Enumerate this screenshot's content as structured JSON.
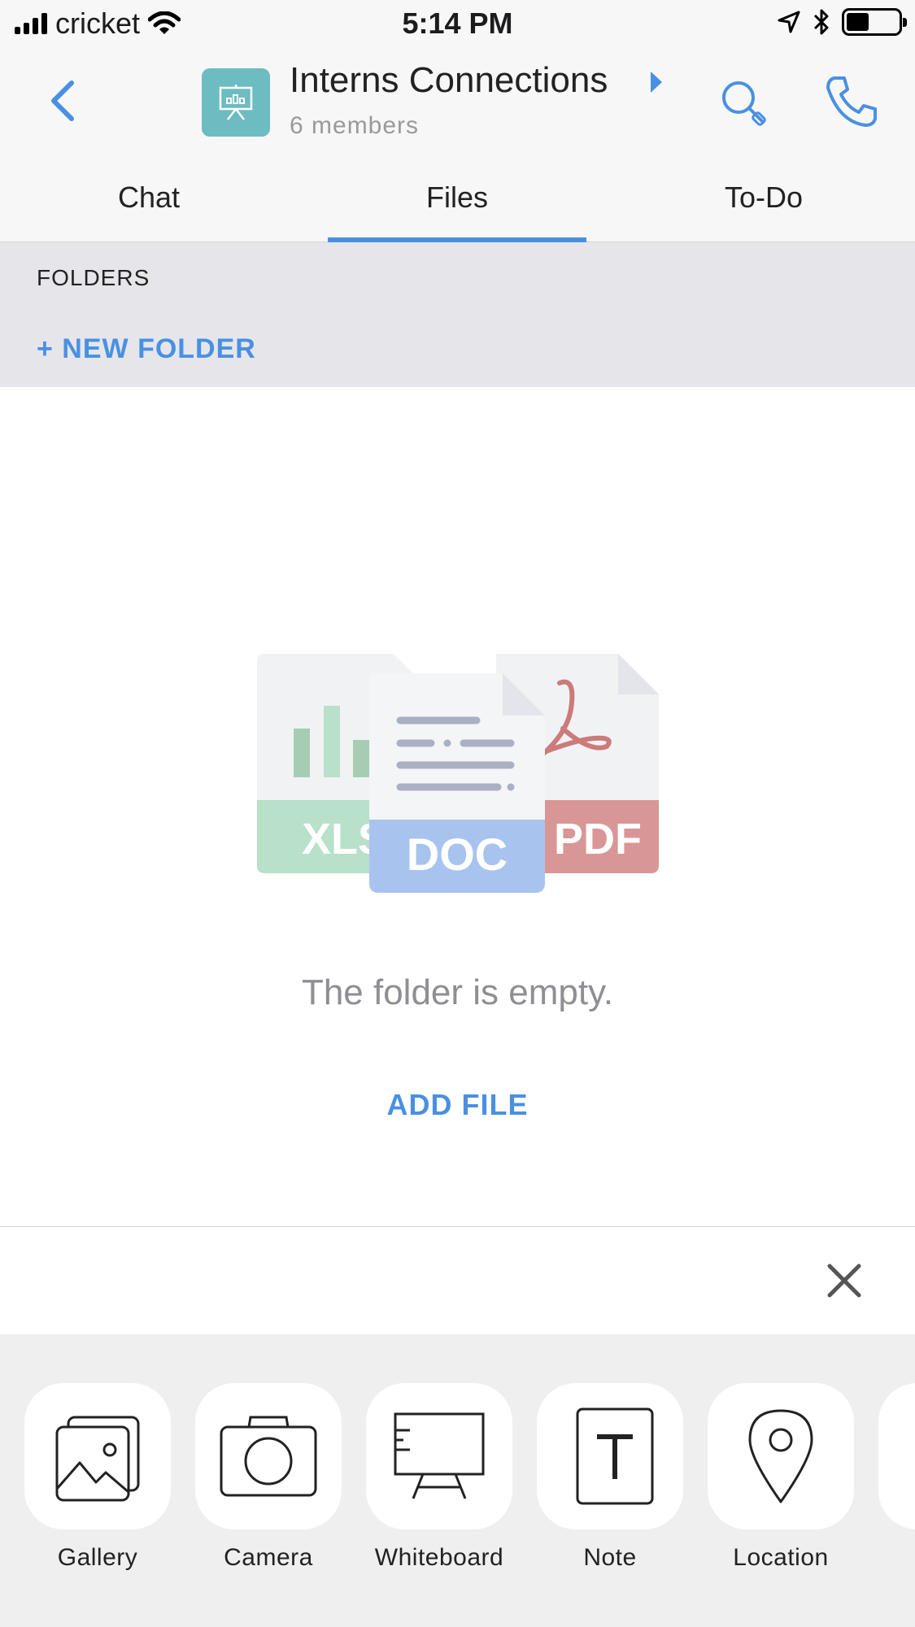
{
  "status_bar": {
    "carrier": "cricket",
    "time": "5:14 PM"
  },
  "header": {
    "title": "Interns Connections",
    "subtitle": "6 members"
  },
  "tabs": [
    {
      "label": "Chat",
      "active": false
    },
    {
      "label": "Files",
      "active": true
    },
    {
      "label": "To-Do",
      "active": false
    }
  ],
  "folders": {
    "section_label": "FOLDERS",
    "new_folder": "+ NEW FOLDER"
  },
  "empty_state": {
    "illustration_labels": {
      "xls": "XLS",
      "doc": "DOC",
      "pdf": "PDF"
    },
    "message": "The folder is empty.",
    "action": "ADD FILE"
  },
  "tray": {
    "items": [
      {
        "label": "Gallery",
        "icon": "gallery-icon"
      },
      {
        "label": "Camera",
        "icon": "camera-icon"
      },
      {
        "label": "Whiteboard",
        "icon": "whiteboard-icon"
      },
      {
        "label": "Note",
        "icon": "note-icon"
      },
      {
        "label": "Location",
        "icon": "location-icon"
      }
    ]
  },
  "colors": {
    "accent": "#4a90e2",
    "avatar": "#6cbcc2",
    "xls": "#b9e0c9",
    "doc": "#a8c4ee",
    "pdf": "#d99696"
  }
}
